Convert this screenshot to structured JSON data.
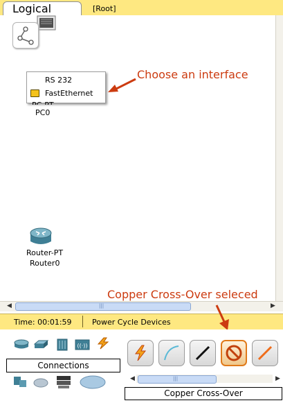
{
  "topbar": {
    "tab_label": "Logical",
    "path": "[Root]"
  },
  "canvas": {
    "interface_menu": {
      "items": [
        "RS 232",
        "FastEthernet"
      ]
    },
    "pc": {
      "type_label": "PC-PT",
      "name": "PC0"
    },
    "router": {
      "type_label": "Router-PT",
      "name": "Router0"
    },
    "annotations": {
      "choose_interface": "Choose an interface",
      "copper_selected": "Copper Cross-Over seleced"
    },
    "accent_color": "#cc3b10"
  },
  "scroll": {
    "grip": "|||"
  },
  "statusbar": {
    "time": "Time: 00:01:59",
    "power_cycle": "Power Cycle Devices"
  },
  "bottom": {
    "category_label": "Connections",
    "selected_cable": "Copper Cross-Over",
    "category_icons": [
      "router-icon",
      "switch-icon",
      "hub-icon",
      "wireless-icon",
      "connection-icon",
      "end-device-icon",
      "wan-emulation-icon",
      "custom-device-icon",
      "multiuser-icon"
    ],
    "cable_icons": [
      "automatic-connection-icon",
      "console-cable-icon",
      "copper-straight-through-icon",
      "copper-cross-over-icon",
      "fiber-icon"
    ]
  }
}
